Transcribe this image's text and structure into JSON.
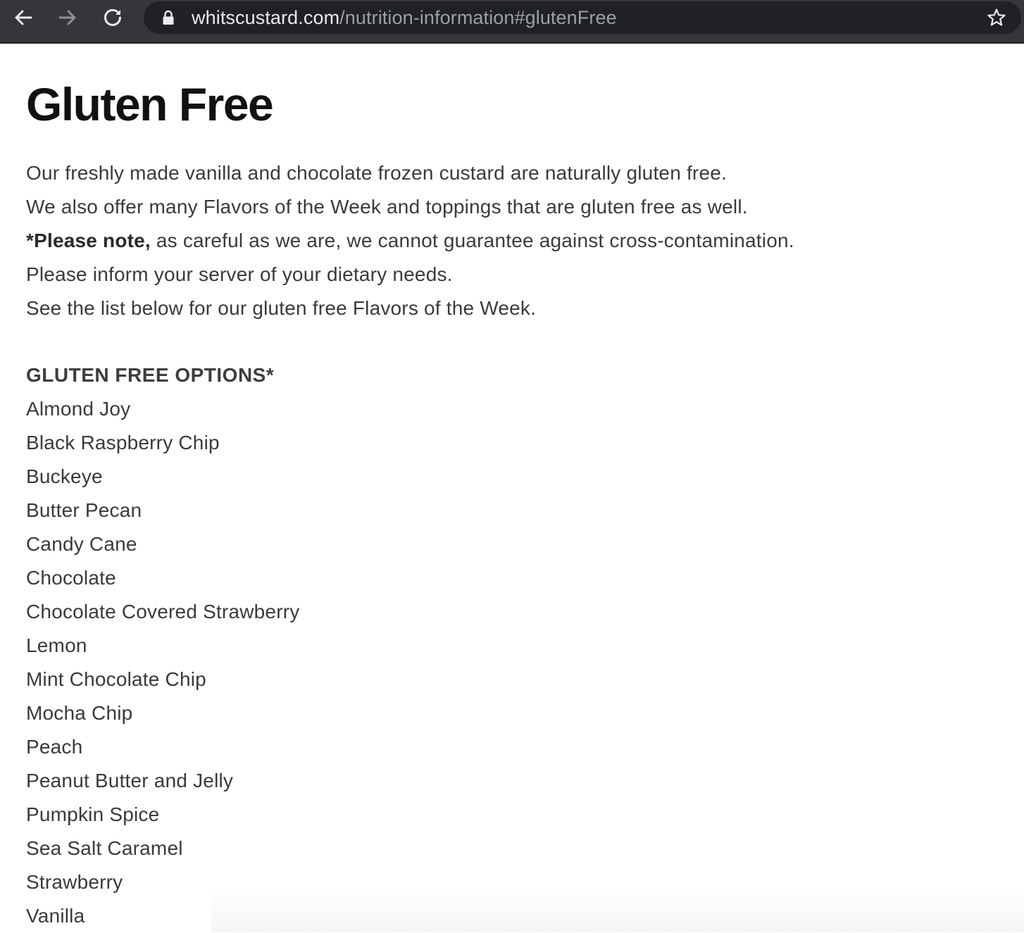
{
  "browser": {
    "url_host": "whitscustard.com",
    "url_path": "/nutrition-information#glutenFree",
    "icons": {
      "back": "arrow-left-icon",
      "forward": "arrow-right-icon",
      "reload": "reload-icon",
      "secure": "lock-icon",
      "bookmark": "star-icon"
    },
    "colors": {
      "toolbar": "#35363a",
      "omnibox": "#202124",
      "url_host": "#e8eaed",
      "url_path": "#9aa0a6"
    }
  },
  "page": {
    "title": "Gluten Free",
    "intro": {
      "line1": "Our freshly made vanilla and chocolate frozen custard are naturally gluten free.",
      "line2": "We also offer many Flavors of the Week and toppings that are gluten free as well.",
      "note_bold": "*Please note,",
      "note_rest": " as careful as we are, we cannot guarantee against cross-contamination.",
      "line4": "Please inform your server of your dietary needs.",
      "line5": "See the list below for our gluten free Flavors of the Week."
    },
    "options_heading": "GLUTEN FREE OPTIONS*",
    "flavors": [
      "Almond Joy",
      "Black Raspberry Chip",
      "Buckeye",
      "Butter Pecan",
      "Candy Cane",
      "Chocolate",
      "Chocolate Covered Strawberry",
      "Lemon",
      "Mint Chocolate Chip",
      "Mocha Chip",
      "Peach",
      "Peanut Butter and Jelly",
      "Pumpkin Spice",
      "Sea Salt Caramel",
      "Strawberry",
      "Vanilla"
    ]
  }
}
